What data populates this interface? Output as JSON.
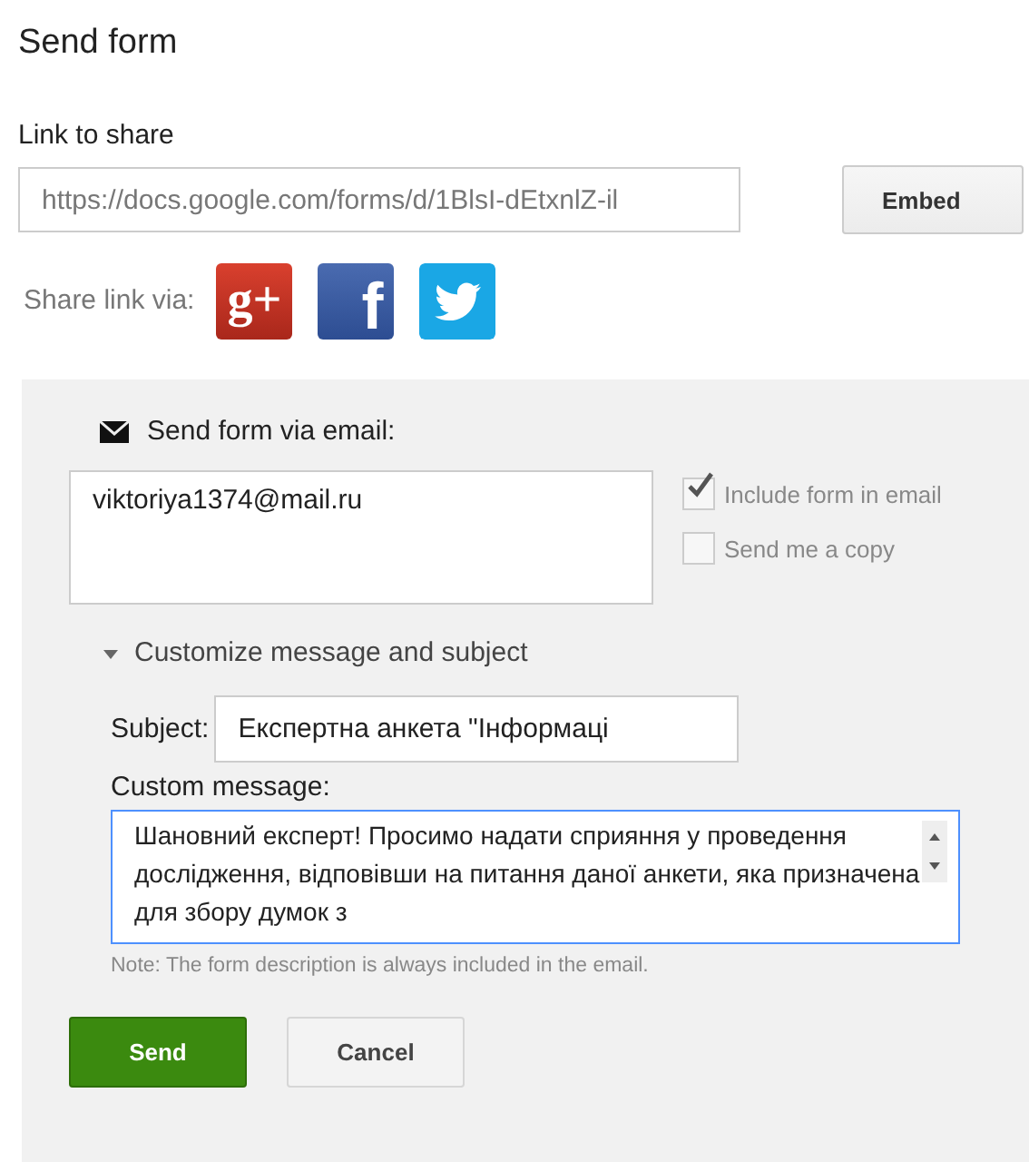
{
  "dialog": {
    "title": "Send form"
  },
  "link": {
    "label": "Link to share",
    "value": "https://docs.google.com/forms/d/1BlsI-dEtxnlZ-il",
    "embed_button": "Embed",
    "share_label": "Share link via:"
  },
  "share_services": [
    {
      "kind": "googleplus",
      "symbol": "g+"
    },
    {
      "kind": "facebook",
      "symbol": "f"
    },
    {
      "kind": "twitter"
    }
  ],
  "email": {
    "heading": "Send form via email:",
    "recipients": "viktoriya1374@mail.ru",
    "options": [
      {
        "label": "Include form in email",
        "checked": true
      },
      {
        "label": "Send me a copy",
        "checked": false
      }
    ],
    "customize": {
      "label": "Customize message and subject",
      "expanded": true,
      "subject_label": "Subject:",
      "subject": "Експертна анкета \"Інформаці",
      "message_label": "Custom message:",
      "message": "Шановний експерт! Просимо надати сприяння у проведення дослідження, відповівши на питання даної анкети, яка призначена для збору думок з",
      "note": "Note: The form description is always included in the email."
    }
  },
  "buttons": [
    {
      "label": "Send",
      "kind": "primary"
    },
    {
      "label": "Cancel",
      "kind": "secondary"
    }
  ]
}
